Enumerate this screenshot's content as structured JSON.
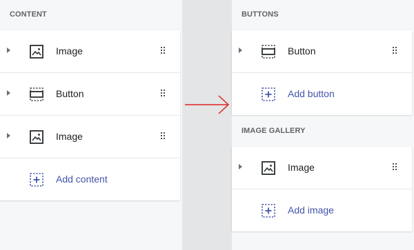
{
  "left_panel": {
    "title": "CONTENT",
    "items": [
      {
        "label": "Image",
        "icon": "image-icon"
      },
      {
        "label": "Button",
        "icon": "button-icon"
      },
      {
        "label": "Image",
        "icon": "image-icon"
      }
    ],
    "add_label": "Add content"
  },
  "right_panel": {
    "buttons_section": {
      "title": "BUTTONS",
      "items": [
        {
          "label": "Button",
          "icon": "button-icon"
        }
      ],
      "add_label": "Add button"
    },
    "gallery_section": {
      "title": "IMAGE GALLERY",
      "items": [
        {
          "label": "Image",
          "icon": "image-icon"
        }
      ],
      "add_label": "Add image"
    }
  },
  "colors": {
    "accent": "#4354a8",
    "arrow": "#e02020",
    "text": "#202124",
    "section_title": "#5f6368"
  }
}
